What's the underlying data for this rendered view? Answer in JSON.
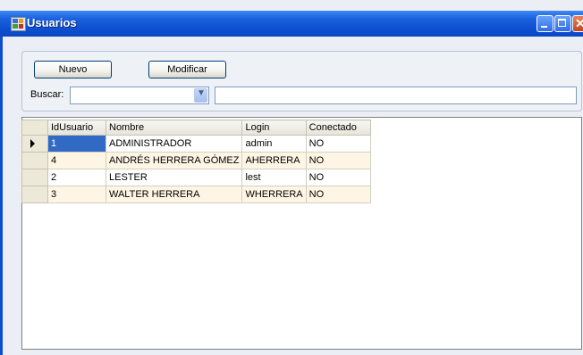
{
  "window": {
    "title": "Usuarios",
    "controls": [
      "minimize-icon",
      "maximize-icon",
      "close-icon"
    ]
  },
  "toolbar": {
    "nuevo_label": "Nuevo",
    "modificar_label": "Modificar"
  },
  "search": {
    "label": "Buscar:",
    "combo_value": "",
    "text_value": ""
  },
  "grid": {
    "columns": [
      "IdUsuario",
      "Nombre",
      "Login",
      "Conectado"
    ],
    "rows": [
      {
        "id": "1",
        "nombre": "ADMINISTRADOR",
        "login": "admin",
        "conectado": "NO"
      },
      {
        "id": "4",
        "nombre": "ANDRÉS HERRERA GÓMEZ",
        "login": "AHERRERA",
        "conectado": "NO"
      },
      {
        "id": "2",
        "nombre": "LESTER",
        "login": "lest",
        "conectado": "NO"
      },
      {
        "id": "3",
        "nombre": "WALTER HERRERA",
        "login": "WHERRERA",
        "conectado": "NO"
      }
    ]
  },
  "colors": {
    "titlebar": "#0d4fd0",
    "selection": "#316ac5",
    "alt_row": "#fff5e5"
  }
}
